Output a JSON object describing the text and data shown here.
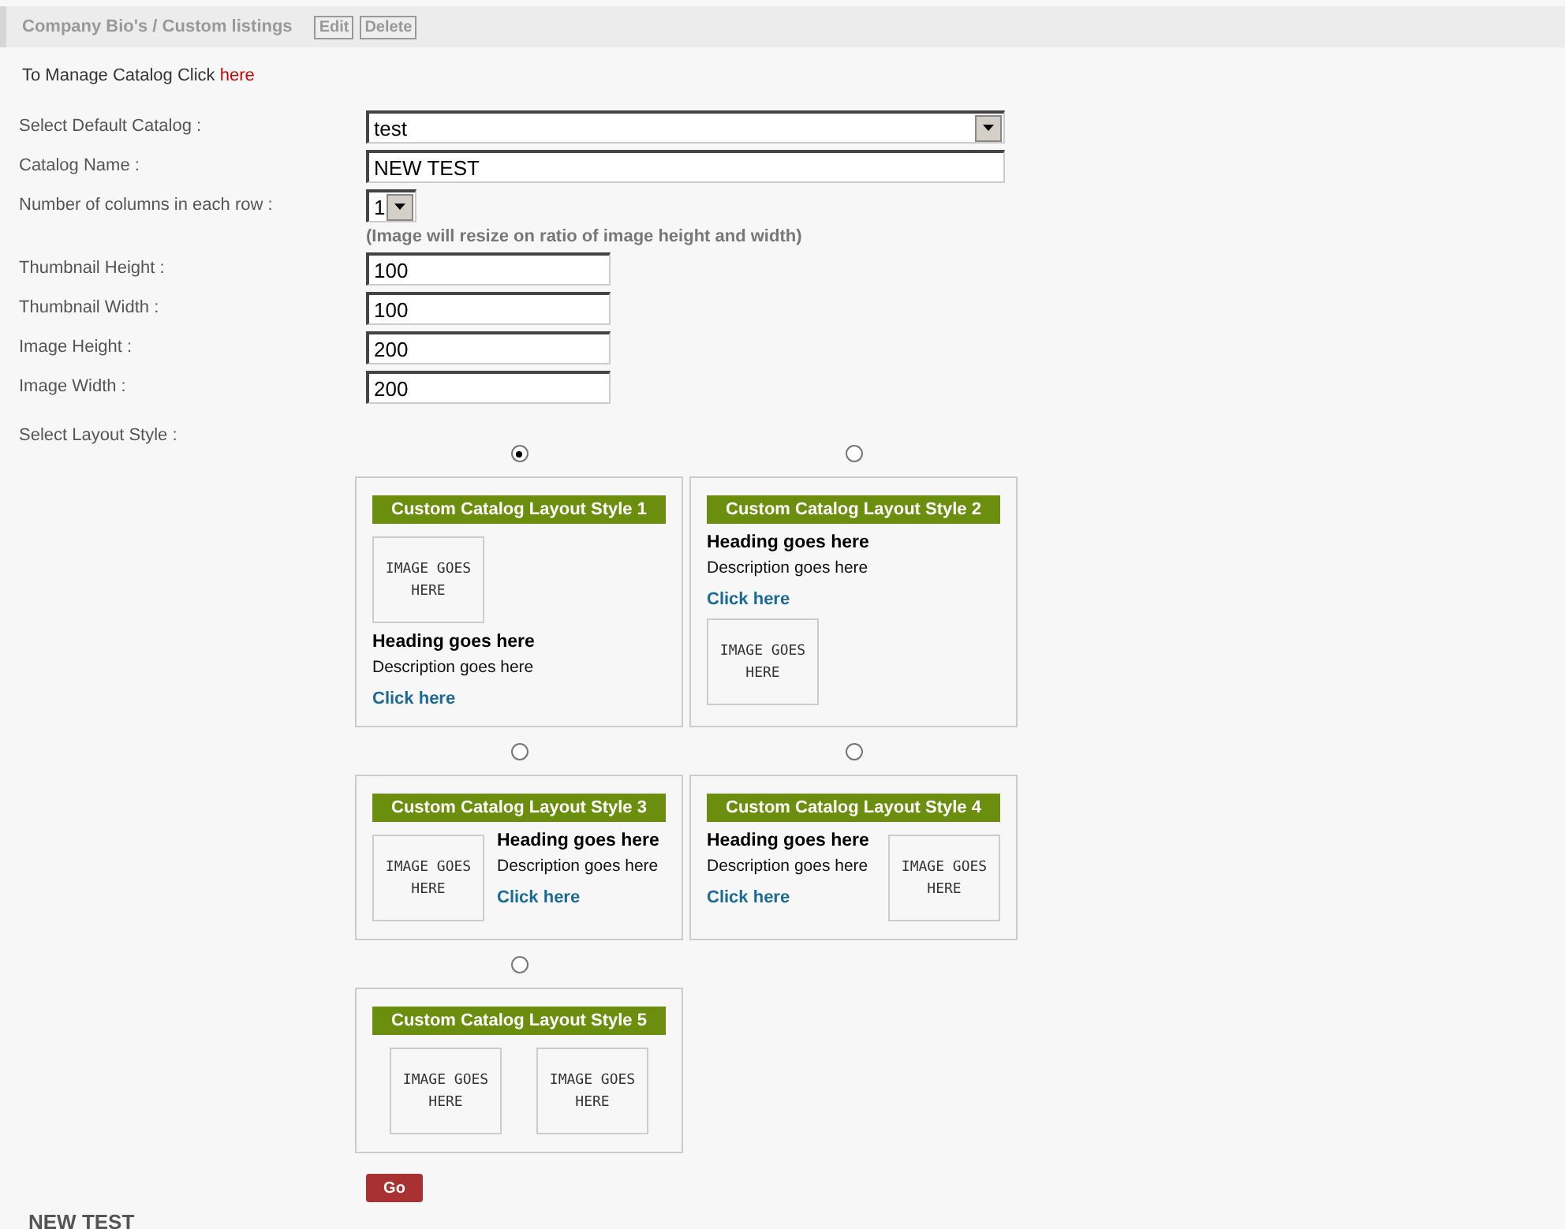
{
  "header": {
    "title": "Company Bio's / Custom listings",
    "buttons": [
      "Edit",
      "Delete"
    ]
  },
  "manage": {
    "text": "To Manage Catalog Click",
    "link": "here"
  },
  "fields": [
    {
      "kind": "select",
      "label": "Select Default Catalog :",
      "value": "test"
    },
    {
      "kind": "text",
      "label": "Catalog Name :",
      "value": "NEW TEST"
    },
    {
      "kind": "select",
      "label": "Number of columns in each row :",
      "value": "1",
      "note": "(Image will resize on ratio of  image height and width)"
    },
    {
      "kind": "text",
      "label": "Thumbnail Height :",
      "value": "100"
    },
    {
      "kind": "text",
      "label": "Thumbnail Width :",
      "value": "100"
    },
    {
      "kind": "text",
      "label": "Image Height :",
      "value": "200"
    },
    {
      "kind": "text",
      "label": "Image Width :",
      "value": "200"
    }
  ],
  "layout_label": "Select Layout Style :",
  "layouts": [
    {
      "kind": "image-top",
      "selected": true,
      "title": "Custom Catalog Layout Style 1",
      "images": [
        "IMAGE GOES HERE"
      ],
      "heading": "Heading goes here",
      "description": "Description goes here",
      "link": "Click here"
    },
    {
      "kind": "image-bottom",
      "selected": false,
      "title": "Custom Catalog Layout Style 2",
      "images": [
        "IMAGE GOES HERE"
      ],
      "heading": "Heading goes here",
      "description": "Description goes here",
      "link": "Click here"
    },
    {
      "kind": "image-left",
      "selected": false,
      "title": "Custom Catalog Layout Style 3",
      "images": [
        "IMAGE GOES HERE"
      ],
      "heading": "Heading goes here",
      "description": "Description goes here",
      "link": "Click here"
    },
    {
      "kind": "image-right",
      "selected": false,
      "title": "Custom Catalog Layout Style 4",
      "images": [
        "IMAGE GOES HERE"
      ],
      "heading": "Heading goes here",
      "description": "Description goes here",
      "link": "Click here"
    },
    {
      "kind": "two-images",
      "selected": false,
      "title": "Custom Catalog Layout Style 5",
      "images": [
        "IMAGE GOES HERE",
        "IMAGE GOES HERE"
      ]
    }
  ],
  "submit": "Go",
  "footer_title": "NEW TEST"
}
